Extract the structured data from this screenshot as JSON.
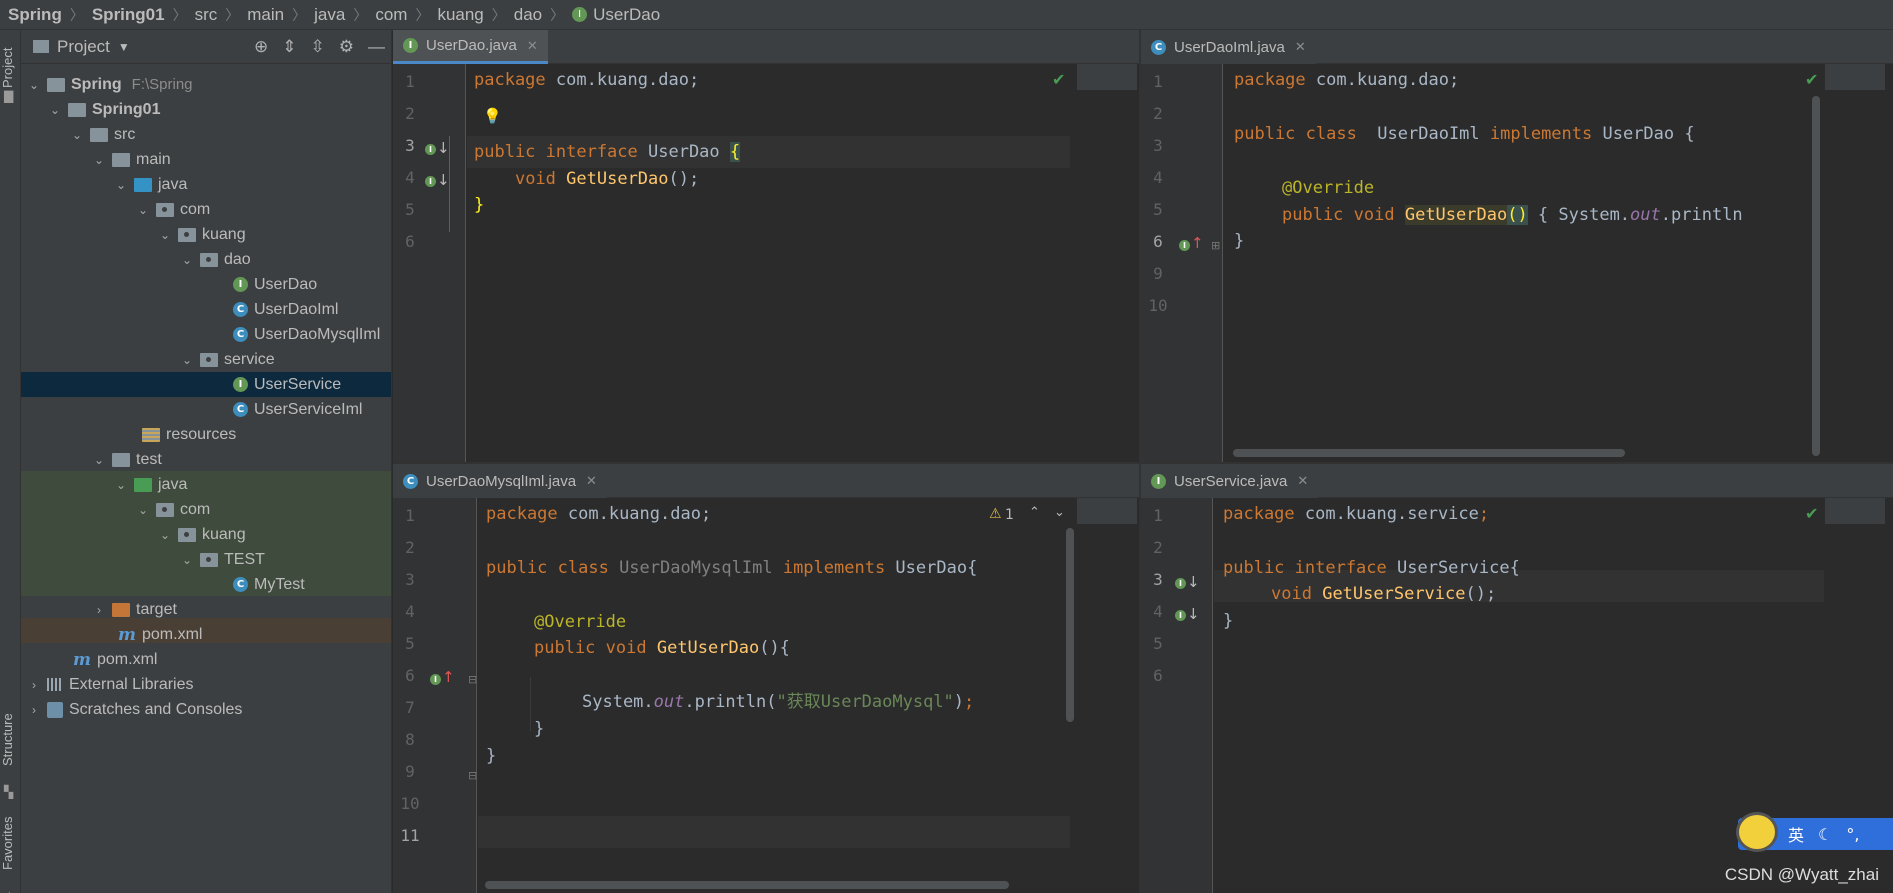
{
  "breadcrumb": [
    "Spring",
    "Spring01",
    "src",
    "main",
    "java",
    "com",
    "kuang",
    "dao",
    "UserDao"
  ],
  "tool_stripe": {
    "project": "Project",
    "structure": "Structure",
    "favorites": "Favorites"
  },
  "project_panel": {
    "title": "Project",
    "root_name": "Spring",
    "root_path": "F:\\Spring",
    "items": {
      "spring01": "Spring01",
      "src": "src",
      "main": "main",
      "java": "java",
      "com": "com",
      "kuang": "kuang",
      "dao": "dao",
      "userdao": "UserDao",
      "userdaoiml": "UserDaoIml",
      "userdaomysqliml": "UserDaoMysqlIml",
      "service": "service",
      "userservice": "UserService",
      "userserviceiml": "UserServiceIml",
      "resources": "resources",
      "test": "test",
      "test_java": "java",
      "test_com": "com",
      "test_kuang": "kuang",
      "test_TEST": "TEST",
      "mytest": "MyTest",
      "target": "target",
      "pom_inner": "pom.xml",
      "pom_outer": "pom.xml",
      "ext_libs": "External Libraries",
      "scratches": "Scratches and Consoles"
    }
  },
  "editors": {
    "top_left": {
      "tab": "UserDao.java",
      "lines": [
        {
          "n": "1",
          "k1": "package",
          "t1": " com.kuang.dao;"
        },
        {
          "n": "2"
        },
        {
          "n": "3",
          "k1": "public interface",
          "t1": " UserDao ",
          "b": "{"
        },
        {
          "n": "4",
          "pre": "    ",
          "k1": "void",
          "t1": " ",
          "fn": "GetUserDao",
          "t2": "();"
        },
        {
          "n": "5",
          "b": "}"
        },
        {
          "n": "6"
        }
      ]
    },
    "top_right": {
      "tab": "UserDaoIml.java",
      "lines": [
        {
          "n": "1",
          "k1": "package",
          "t1": " com.kuang.dao;"
        },
        {
          "n": "2"
        },
        {
          "n": "3",
          "k1": "public class",
          "t1": "  UserDaoIml ",
          "k2": "implements",
          "t2": " UserDao {"
        },
        {
          "n": "4"
        },
        {
          "n": "5",
          "ann": "@Override"
        },
        {
          "n": "6",
          "k1": "public void",
          "t1": " ",
          "fn": "GetUserDao",
          "par": "()",
          "t2": " { System.",
          "it": "out",
          "t3": ".println"
        },
        {
          "n": "9",
          "t1": "}"
        },
        {
          "n": "10"
        }
      ]
    },
    "bottom_left": {
      "tab": "UserDaoMysqlIml.java",
      "warning_count": "1",
      "lines": [
        {
          "n": "1",
          "k1": "package",
          "t1": " com.kuang.dao;"
        },
        {
          "n": "2"
        },
        {
          "n": "3",
          "k1": "public class",
          "dim": " UserDaoMysqlIml ",
          "k2": "implements",
          "t2": " UserDao{"
        },
        {
          "n": "4"
        },
        {
          "n": "5",
          "ann": "@Override"
        },
        {
          "n": "6",
          "k1": "public void",
          "t1": " ",
          "fn": "GetUserDao",
          "t2": "(){"
        },
        {
          "n": "7"
        },
        {
          "n": "8",
          "t1": "System.",
          "it": "out",
          "t2": ".println(",
          "str": "\"获取UserDaoMysql\"",
          "k2": ";",
          "t3": ")"
        },
        {
          "n": "9",
          "t1": "}"
        },
        {
          "n": "10",
          "t1": "}"
        },
        {
          "n": "11"
        }
      ]
    },
    "bottom_right": {
      "tab": "UserService.java",
      "lines": [
        {
          "n": "1",
          "k1": "package",
          "t1": " com.kuang.service",
          "k2": ";"
        },
        {
          "n": "2"
        },
        {
          "n": "3",
          "k1": "public interface",
          "t1": " UserService{"
        },
        {
          "n": "4",
          "k1": "void",
          "t1": " ",
          "fn": "GetUserService",
          "t2": "();"
        },
        {
          "n": "5",
          "t1": "}"
        },
        {
          "n": "6"
        }
      ]
    }
  },
  "ime": {
    "lang": "英",
    "moon": "☾",
    "punct": "°,"
  },
  "watermark": "CSDN @Wyatt_zhai",
  "colors": {
    "keyword": "#cc7832",
    "function": "#ffc66d",
    "annotation": "#bbb529",
    "string": "#6a8759",
    "accent": "#4a88c7",
    "selection": "#0d293e"
  }
}
